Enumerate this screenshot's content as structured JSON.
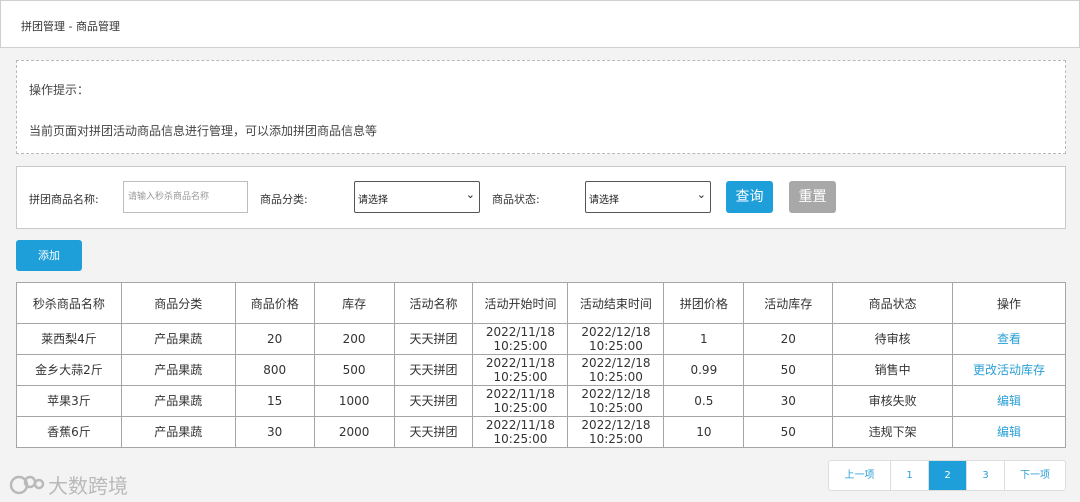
{
  "breadcrumb": "拼团管理 - 商品管理",
  "tips": {
    "title": "操作提示：",
    "text": "当前页面对拼团活动商品信息进行管理，可以添加拼团商品信息等"
  },
  "filter": {
    "name_label": "拼团商品名称:",
    "name_placeholder": "请输入秒杀商品名称",
    "category_label": "商品分类:",
    "category_value": "请选择",
    "status_label": "商品状态:",
    "status_value": "请选择",
    "query_label": "查询",
    "reset_label": "重置"
  },
  "add_label": "添加",
  "table": {
    "headers": [
      "秒杀商品名称",
      "商品分类",
      "商品价格",
      "库存",
      "活动名称",
      "活动开始时间",
      "活动结束时间",
      "拼团价格",
      "活动库存",
      "商品状态",
      "操作"
    ],
    "rows": [
      {
        "name": "莱西梨4斤",
        "category": "产品果蔬",
        "price": "20",
        "stock": "200",
        "activity": "天天拼团",
        "start_date": "2022/11/18",
        "start_time": "10:25:00",
        "end_date": "2022/12/18",
        "end_time": "10:25:00",
        "group_price": "1",
        "activity_stock": "20",
        "status": "待审核",
        "action": "查看"
      },
      {
        "name": "金乡大蒜2斤",
        "category": "产品果蔬",
        "price": "800",
        "stock": "500",
        "activity": "天天拼团",
        "start_date": "2022/11/18",
        "start_time": "10:25:00",
        "end_date": "2022/12/18",
        "end_time": "10:25:00",
        "group_price": "0.99",
        "activity_stock": "50",
        "status": "销售中",
        "action": "更改活动库存"
      },
      {
        "name": "苹果3斤",
        "category": "产品果蔬",
        "price": "15",
        "stock": "1000",
        "activity": "天天拼团",
        "start_date": "2022/11/18",
        "start_time": "10:25:00",
        "end_date": "2022/12/18",
        "end_time": "10:25:00",
        "group_price": "0.5",
        "activity_stock": "30",
        "status": "审核失败",
        "action": "编辑"
      },
      {
        "name": "香蕉6斤",
        "category": "产品果蔬",
        "price": "30",
        "stock": "2000",
        "activity": "天天拼团",
        "start_date": "2022/11/18",
        "start_time": "10:25:00",
        "end_date": "2022/12/18",
        "end_time": "10:25:00",
        "group_price": "10",
        "activity_stock": "50",
        "status": "违规下架",
        "action": "编辑"
      }
    ]
  },
  "pager": {
    "prev": "上一项",
    "pages": [
      "1",
      "2",
      "3"
    ],
    "active": "2",
    "next": "下一项"
  },
  "watermark": "大数跨境"
}
